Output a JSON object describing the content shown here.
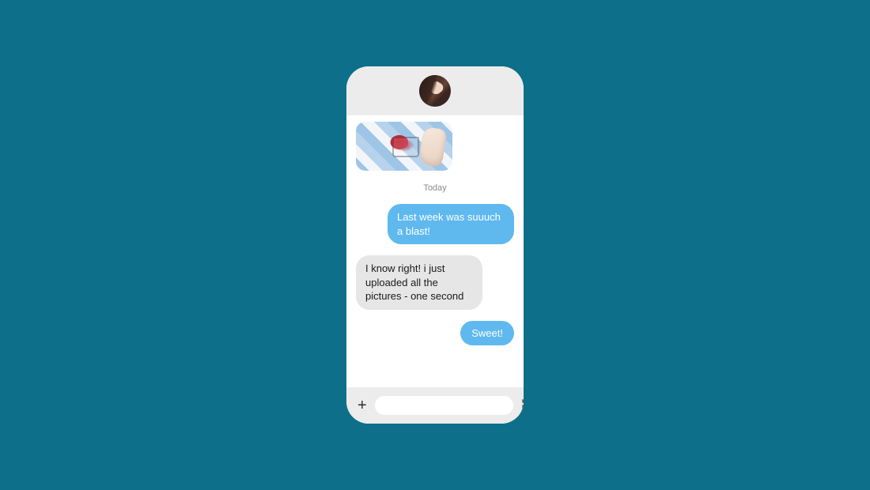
{
  "header": {
    "avatar_name": "contact-avatar"
  },
  "timeline": {
    "divider_label": "Today"
  },
  "messages": {
    "m1": {
      "text": "Last week was suuuch a blast!",
      "direction": "sent"
    },
    "m2": {
      "text": "I know right! i just uploaded all the pictures - one second",
      "direction": "received"
    },
    "m3": {
      "text": "Sweet!",
      "direction": "sent"
    }
  },
  "composer": {
    "add_symbol": "+",
    "input_placeholder": "",
    "input_value": ""
  },
  "icons": {
    "send": "paper-plane-icon",
    "add": "plus-icon"
  },
  "colors": {
    "background": "#0d6f89",
    "sent_bubble": "#5fb9ef",
    "received_bubble": "#e6e6e6",
    "chrome": "#ececec"
  }
}
